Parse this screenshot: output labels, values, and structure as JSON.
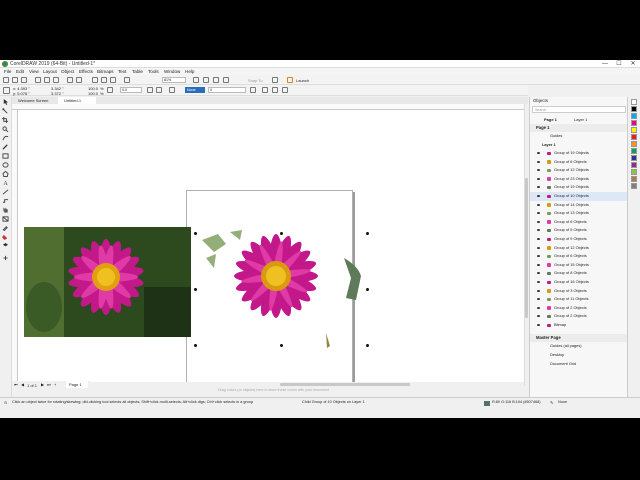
{
  "window": {
    "title": "CorelDRAW 2019 (64-Bit) - Untitled-1*",
    "minimize": "—",
    "maximize": "☐",
    "close": "✕"
  },
  "menu": [
    "File",
    "Edit",
    "View",
    "Layout",
    "Object",
    "Effects",
    "Bitmaps",
    "Text",
    "Table",
    "Tools",
    "Window",
    "Help"
  ],
  "toolbar": {
    "zoom": "81%",
    "snap_to": "Snap To",
    "launch": "Launch"
  },
  "property_bar": {
    "x": "x: 4.393 \"",
    "y": "y: 5.078 \"",
    "width": "3.342 \"",
    "height": "3.372 \"",
    "scale_w": "100.0",
    "scale_h": "100.0",
    "percent": "%",
    "angle": "0.0",
    "outline_none": "None",
    "outline_width": "0"
  },
  "tabs": {
    "welcome": "Welcome Screen",
    "document": "Untitled-1"
  },
  "page_nav": {
    "counter": "1 of 1",
    "page_label": "Page 1"
  },
  "canvas_hint": "Drag colors (or objects) here to store these colors with your document",
  "objects_docker": {
    "title": "Objects",
    "search_placeholder": "Search",
    "page_selector": "Page 1",
    "layer_selector": "Layer 1",
    "page": "Page 1",
    "guides": "Guides",
    "layer": "Layer 1",
    "items": [
      "Group of 19 Objects",
      "Group of 6 Objects",
      "Group of 12 Objects",
      "Group of 23 Objects",
      "Group of 19 Objects",
      "Group of 10 Objects",
      "Group of 14 Objects",
      "Group of 13 Objects",
      "Group of 6 Objects",
      "Group of 5 Objects",
      "Group of 9 Objects",
      "Group of 12 Objects",
      "Group of 6 Objects",
      "Group of 15 Objects",
      "Group of 8 Objects",
      "Group of 16 Objects",
      "Group of 3 Objects",
      "Group of 11 Objects",
      "Group of 2 Objects",
      "Group of 2 Objects",
      "Bitmap"
    ],
    "selected_index": 5,
    "master_page": "Master Page",
    "master_items": [
      "Guides (all pages)",
      "Desktop",
      "Document Grid"
    ]
  },
  "status": {
    "hint": "Click an object twice for rotating/skewing; dbl-clicking tool selects all objects; Shift+click multi-selects; Alt+click digs; Ctrl+click selects in a group",
    "selection": "Child Group of 10 Objects on Layer 1",
    "fill": "R:80 G:116 B:104 (#507468)",
    "outline": "None"
  },
  "colors": {
    "accent": "#2a6ebb",
    "selection": "#dde8f6"
  }
}
